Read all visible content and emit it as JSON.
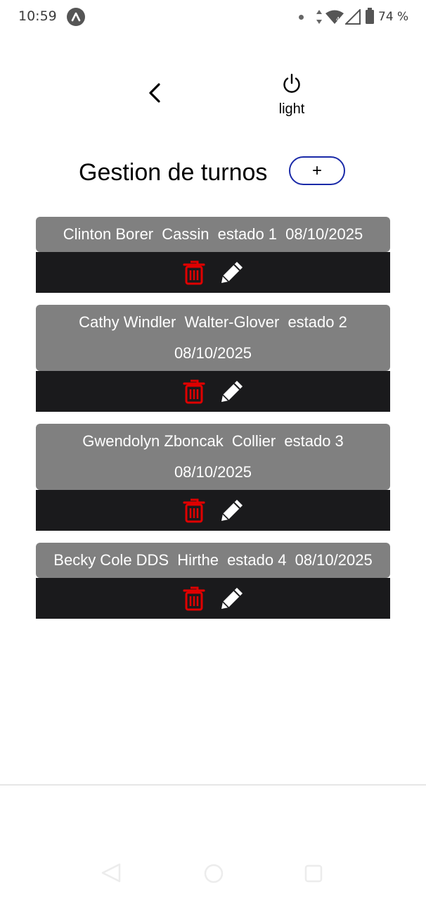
{
  "status_bar": {
    "time": "10:59",
    "app_icon": "android-app-icon",
    "battery": "74 %",
    "icons": [
      "notification-dot-icon",
      "data-arrows-icon",
      "wifi-icon",
      "signal-icon",
      "battery-icon"
    ]
  },
  "header": {
    "back_icon": "chevron-left-icon",
    "theme_toggle_icon": "power-icon",
    "theme_label": "light"
  },
  "page": {
    "title": "Gestion de turnos",
    "add_label": "+"
  },
  "turnos": [
    {
      "name": "Clinton Borer",
      "company": "Cassin",
      "estado": "estado 1",
      "date": "08/10/2025"
    },
    {
      "name": "Cathy Windler",
      "company": "Walter-Glover",
      "estado": "estado 2",
      "date": "08/10/2025"
    },
    {
      "name": "Gwendolyn Zboncak",
      "company": "Collier",
      "estado": "estado 3",
      "date": "08/10/2025"
    },
    {
      "name": "Becky Cole DDS",
      "company": "Hirthe",
      "estado": "estado 4",
      "date": "08/10/2025"
    }
  ],
  "actions": {
    "delete_icon": "trash-icon",
    "edit_icon": "pencil-icon",
    "delete_color": "#e00000",
    "edit_color": "#ffffff"
  },
  "colors": {
    "card_info_bg": "#808080",
    "card_actions_bg": "#1a1a1c",
    "add_button_border": "#1a2aa8"
  },
  "nav_bar": {
    "icons": [
      "nav-back-icon",
      "nav-home-icon",
      "nav-recents-icon"
    ]
  }
}
